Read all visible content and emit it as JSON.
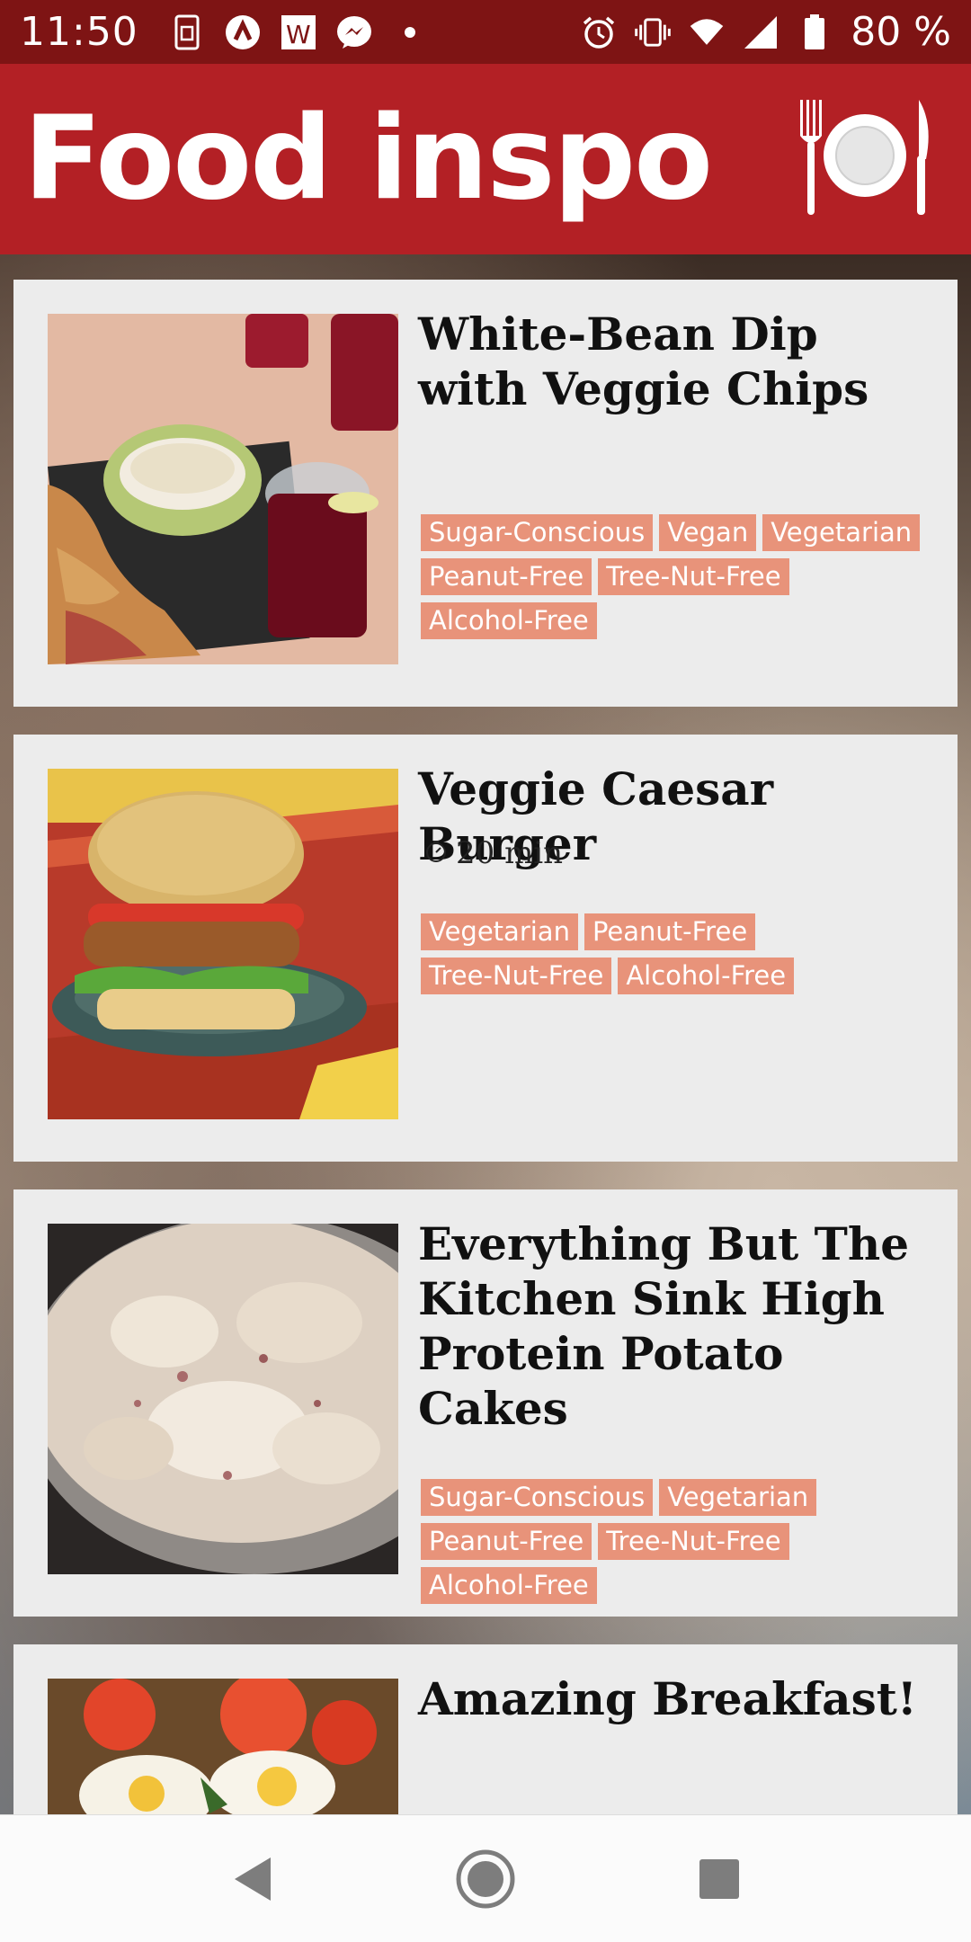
{
  "status_bar": {
    "time": "11:50",
    "battery": "80 %",
    "left_icons": [
      "sim-icon",
      "arrow-app-icon",
      "w-app-icon",
      "messenger-icon",
      "dot-icon"
    ],
    "right_icons": [
      "alarm-icon",
      "vibrate-icon",
      "wifi-icon",
      "signal-icon",
      "battery-icon"
    ]
  },
  "app_bar": {
    "title": "Food inspo",
    "logo_icon": "plate-cutlery-icon",
    "color": "#b32025"
  },
  "recipes": [
    {
      "title": "White-Bean Dip with Veggie Chips",
      "time": "",
      "tags": [
        "Sugar-Conscious",
        "Vegan",
        "Vegetarian",
        "Peanut-Free",
        "Tree-Nut-Free",
        "Alcohol-Free"
      ]
    },
    {
      "title": "Veggie Caesar Burger",
      "time": "20 min",
      "tags": [
        "Vegetarian",
        "Peanut-Free",
        "Tree-Nut-Free",
        "Alcohol-Free"
      ]
    },
    {
      "title": "Everything But The Kitchen Sink High Protein Potato Cakes",
      "time": "",
      "tags": [
        "Sugar-Conscious",
        "Vegetarian",
        "Peanut-Free",
        "Tree-Nut-Free",
        "Alcohol-Free"
      ]
    },
    {
      "title": "Amazing Breakfast!",
      "time": "",
      "tags": []
    }
  ],
  "nav_bar": {
    "buttons": [
      "back-icon",
      "home-icon",
      "recents-icon"
    ]
  },
  "colors": {
    "tag": "#e8937a",
    "card": "#ececec",
    "status_bar": "#7e1414"
  }
}
